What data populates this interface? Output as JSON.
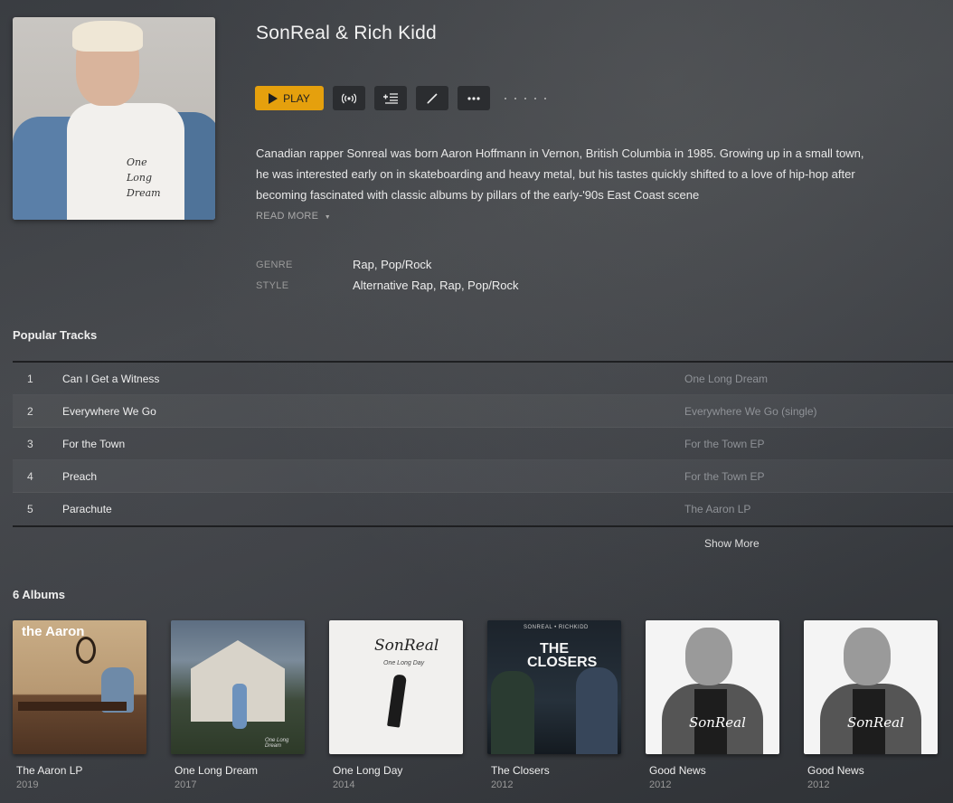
{
  "artist": {
    "name": "SonReal & Rich Kidd",
    "art_text": [
      "One",
      "Long",
      "Dream"
    ],
    "bio": "Canadian rapper Sonreal was born Aaron Hoffmann in Vernon, British Columbia in 1985. Growing up in a small town, he was interested early on in skateboarding and heavy metal, but his tastes quickly shifted to a love of hip-hop after becoming fascinated with classic albums by pillars of the early-'90s East Coast scene",
    "read_more": "READ MORE",
    "meta": [
      {
        "key": "GENRE",
        "value": "Rap, Pop/Rock"
      },
      {
        "key": "STYLE",
        "value": "Alternative Rap, Rap, Pop/Rock"
      }
    ]
  },
  "actions": {
    "play_label": "PLAY",
    "icons": [
      "radio-icon",
      "add-to-queue-icon",
      "edit-icon",
      "more-icon"
    ]
  },
  "popular_tracks": {
    "title": "Popular Tracks",
    "items": [
      {
        "num": "1",
        "name": "Can I Get a Witness",
        "album": "One Long Dream"
      },
      {
        "num": "2",
        "name": "Everywhere We Go",
        "album": "Everywhere We Go (single)"
      },
      {
        "num": "3",
        "name": "For the Town",
        "album": "For the Town EP"
      },
      {
        "num": "4",
        "name": "Preach",
        "album": "For the Town EP"
      },
      {
        "num": "5",
        "name": "Parachute",
        "album": "The Aaron LP"
      }
    ],
    "show_more": "Show More"
  },
  "albums": {
    "title": "6 Albums",
    "items": [
      {
        "title": "The Aaron LP",
        "year": "2019",
        "cover_text": "the Aaron"
      },
      {
        "title": "One Long Dream",
        "year": "2017",
        "cover_text": "One Long Dream"
      },
      {
        "title": "One Long Day",
        "year": "2014",
        "cover_text": "SonReal"
      },
      {
        "title": "The Closers",
        "year": "2012",
        "cover_text": "THE CLOSERS"
      },
      {
        "title": "Good News",
        "year": "2012",
        "cover_text": "SonReal"
      },
      {
        "title": "Good News",
        "year": "2012",
        "cover_text": "SonReal"
      }
    ],
    "closers_top": "SONREAL • RICHKIDD",
    "one_long_day_sub": "One Long Day"
  },
  "colors": {
    "accent": "#e5a00d",
    "button_bg": "#2b2d30"
  }
}
